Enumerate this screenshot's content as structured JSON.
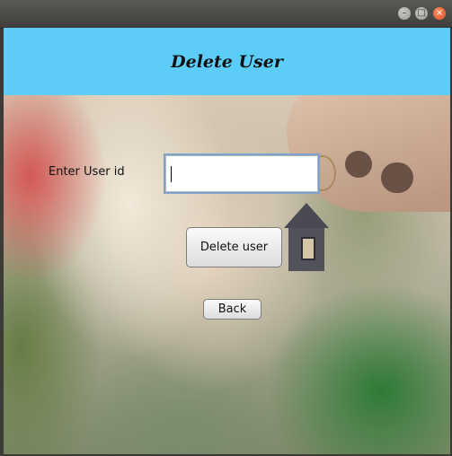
{
  "window": {
    "controls": {
      "minimize_icon": "minimize-icon",
      "maximize_icon": "maximize-icon",
      "close_icon": "close-icon"
    }
  },
  "header": {
    "title": "Delete User",
    "background_color": "#5bcdf8"
  },
  "form": {
    "user_id_label": "Enter User id",
    "user_id_value": "",
    "delete_button_label": "Delete user",
    "back_button_label": "Back"
  }
}
